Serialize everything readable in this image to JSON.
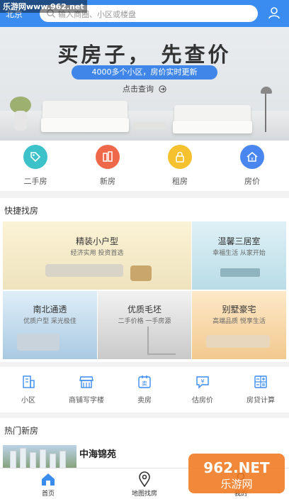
{
  "watermark_top": "乐游网www.962.net",
  "watermark_bottom": {
    "logo": "962.NET",
    "tagline": "乐游网"
  },
  "header": {
    "city": "北京",
    "search_placeholder": "输入商圈、小区或楼盘"
  },
  "banner": {
    "title": "买房子， 先查价",
    "pill": "4000多个小区，房价实时更新",
    "link": "点击查询"
  },
  "categories": [
    {
      "label": "二手房",
      "icon": "tag-icon",
      "color": "#3cc2c8"
    },
    {
      "label": "新房",
      "icon": "building-icon",
      "color": "#f0684a"
    },
    {
      "label": "租房",
      "icon": "lock-icon",
      "color": "#f5c12e"
    },
    {
      "label": "房价",
      "icon": "house-price-icon",
      "color": "#4a86f0"
    }
  ],
  "quick": {
    "title": "快捷找房",
    "tiles": [
      {
        "title": "精装小户型",
        "subtitle": "经济实用 投资首选"
      },
      {
        "title": "温馨三居室",
        "subtitle": "幸福生活 从家开始"
      },
      {
        "title": "南北通透",
        "subtitle": "优质户型 采光极佳"
      },
      {
        "title": "优质毛坯",
        "subtitle": "二手价格 一手房源"
      },
      {
        "title": "别墅豪宅",
        "subtitle": "高端品质 悦享生活"
      }
    ]
  },
  "tools": [
    {
      "label": "小区",
      "icon": "community-icon"
    },
    {
      "label": "商铺写字楼",
      "icon": "shop-icon"
    },
    {
      "label": "卖房",
      "icon": "sell-icon",
      "badge": "卖"
    },
    {
      "label": "估房价",
      "icon": "estimate-icon",
      "badge": "¥"
    },
    {
      "label": "房贷计算",
      "icon": "calculator-icon"
    }
  ],
  "hot": {
    "title": "热门新房",
    "item_name": "中海锦苑"
  },
  "nav": [
    {
      "label": "首页",
      "icon": "home-icon"
    },
    {
      "label": "地图找房",
      "icon": "map-pin-icon"
    },
    {
      "label": "我的",
      "icon": "profile-icon"
    }
  ]
}
